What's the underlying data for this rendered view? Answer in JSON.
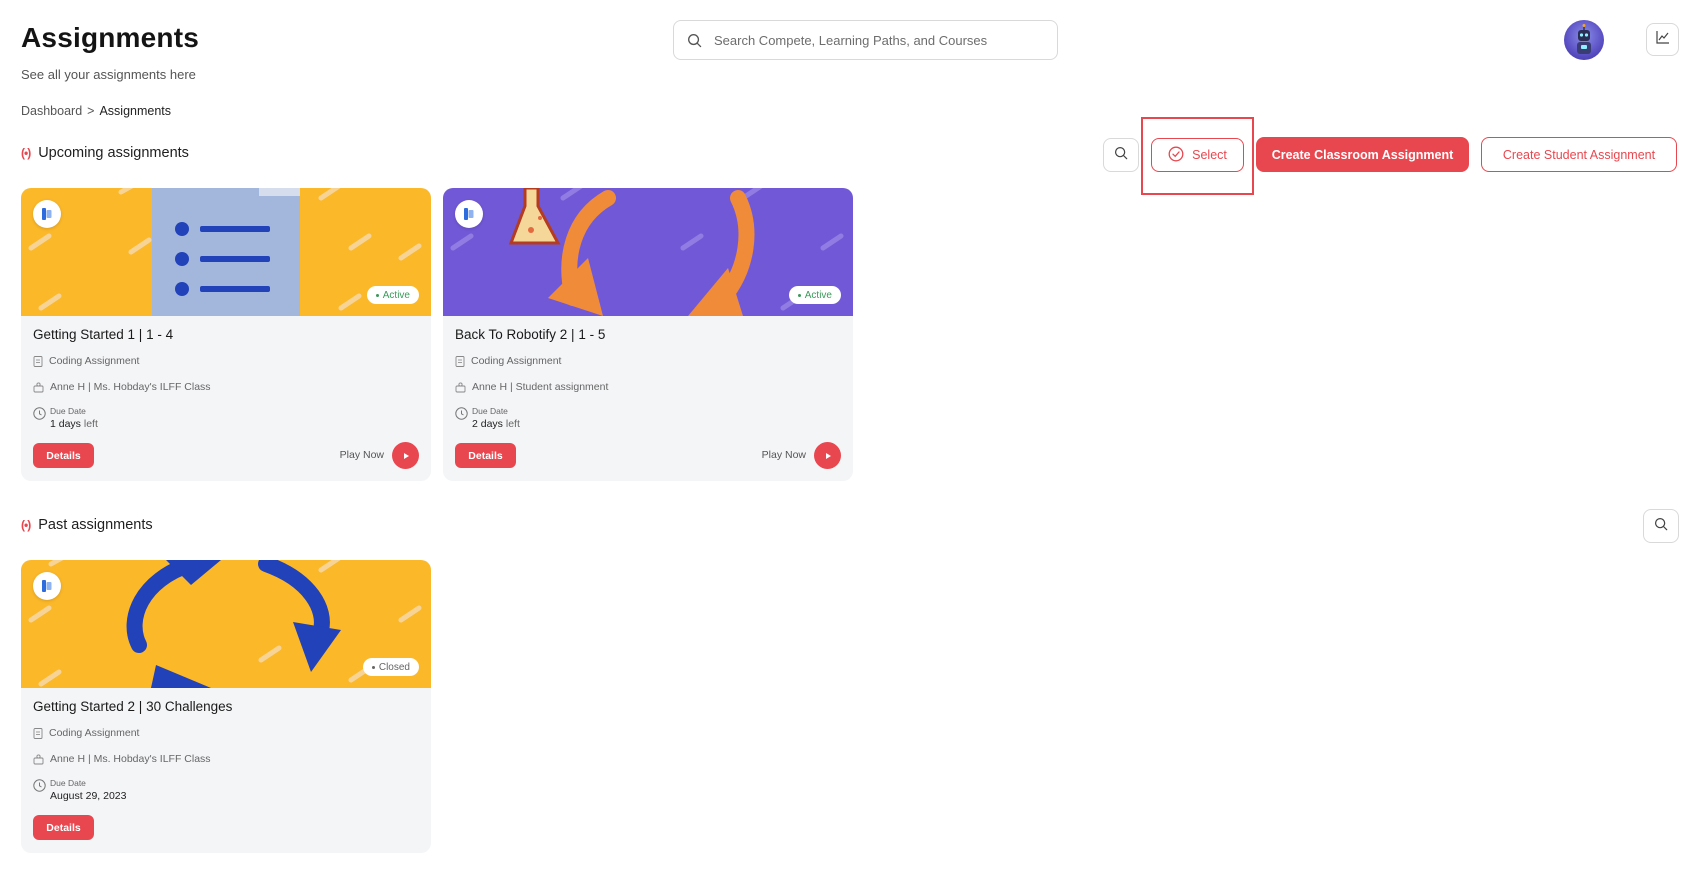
{
  "header": {
    "title": "Assignments",
    "subtitle": "See all your assignments here",
    "search_placeholder": "Search Compete, Learning Paths, and Courses"
  },
  "breadcrumb": {
    "root": "Dashboard",
    "separator": ">",
    "current": "Assignments"
  },
  "upcoming": {
    "section_title": "Upcoming assignments",
    "section_glyph": "(•)",
    "select_label": "Select",
    "create_classroom_label": "Create Classroom Assignment",
    "create_student_label": "Create Student Assignment",
    "cards": [
      {
        "title": "Getting Started 1 | 1 - 4",
        "type": "Coding Assignment",
        "owner": "Anne H | Ms. Hobday's ILFF Class",
        "due_label": "Due Date",
        "due_value": "1 days",
        "due_suffix": "left",
        "status": "Active",
        "details_label": "Details",
        "play_label": "Play Now",
        "banner_color": "#fbb829"
      },
      {
        "title": "Back To Robotify 2 | 1 - 5",
        "type": "Coding Assignment",
        "owner": "Anne H | Student assignment",
        "due_label": "Due Date",
        "due_value": "2 days",
        "due_suffix": "left",
        "status": "Active",
        "details_label": "Details",
        "play_label": "Play Now",
        "banner_color": "#7158d6"
      }
    ]
  },
  "past": {
    "section_title": "Past assignments",
    "section_glyph": "(•)",
    "cards": [
      {
        "title": "Getting Started 2 | 30 Challenges",
        "type": "Coding Assignment",
        "owner": "Anne H | Ms. Hobday's ILFF Class",
        "due_label": "Due Date",
        "due_value": "August 29, 2023",
        "status": "Closed",
        "details_label": "Details",
        "banner_color": "#fbb829"
      }
    ]
  },
  "colors": {
    "accent": "#e8474f",
    "active": "#3a9a58",
    "card_bg": "#f4f5f7"
  }
}
